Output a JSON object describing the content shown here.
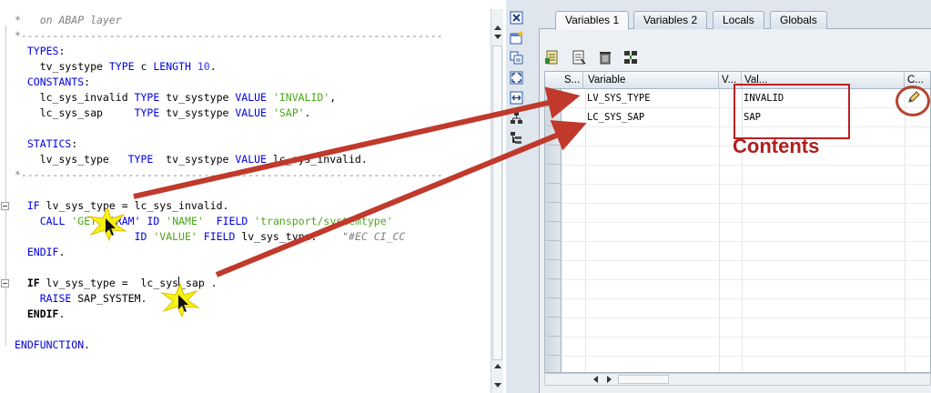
{
  "editor": {
    "lines": [
      {
        "segs": [
          [
            "*   on ABAP layer",
            "comment"
          ]
        ]
      },
      {
        "segs": [
          [
            "*-------------------------------------------------------------------",
            "comment"
          ]
        ]
      },
      {
        "segs": [
          [
            "  ",
            "id"
          ],
          [
            "TYPES",
            "kw"
          ],
          [
            ":",
            "id"
          ]
        ]
      },
      {
        "segs": [
          [
            "    tv_systype ",
            "id"
          ],
          [
            "TYPE",
            "kw"
          ],
          [
            " c ",
            "id"
          ],
          [
            "LENGTH",
            "kw"
          ],
          [
            " ",
            "id"
          ],
          [
            "10",
            "num"
          ],
          [
            ".",
            "id"
          ]
        ]
      },
      {
        "segs": [
          [
            "  ",
            "id"
          ],
          [
            "CONSTANTS",
            "kw"
          ],
          [
            ":",
            "id"
          ]
        ]
      },
      {
        "segs": [
          [
            "    lc_sys_invalid ",
            "id"
          ],
          [
            "TYPE",
            "kw"
          ],
          [
            " tv_systype ",
            "id"
          ],
          [
            "VALUE",
            "kw"
          ],
          [
            " ",
            "id"
          ],
          [
            "'INVALID'",
            "str"
          ],
          [
            ",",
            "id"
          ]
        ]
      },
      {
        "segs": [
          [
            "    lc_sys_sap     ",
            "id"
          ],
          [
            "TYPE",
            "kw"
          ],
          [
            " tv_systype ",
            "id"
          ],
          [
            "VALUE",
            "kw"
          ],
          [
            " ",
            "id"
          ],
          [
            "'SAP'",
            "str"
          ],
          [
            ".",
            "id"
          ]
        ]
      },
      {
        "segs": [
          [
            "",
            "id"
          ]
        ]
      },
      {
        "segs": [
          [
            "  ",
            "id"
          ],
          [
            "STATICS",
            "kw"
          ],
          [
            ":",
            "id"
          ]
        ]
      },
      {
        "segs": [
          [
            "    lv_sys_type   ",
            "id"
          ],
          [
            "TYPE",
            "kw"
          ],
          [
            "  tv_systype ",
            "id"
          ],
          [
            "VALUE",
            "kw"
          ],
          [
            " lc_sys_invalid.",
            "id"
          ]
        ]
      },
      {
        "segs": [
          [
            "*-------------------------------------------------------------------",
            "comment"
          ]
        ]
      },
      {
        "segs": [
          [
            "",
            "id"
          ]
        ]
      },
      {
        "fold": true,
        "segs": [
          [
            "  ",
            "id"
          ],
          [
            "IF",
            "kw"
          ],
          [
            " lv_sys_type = lc_sys_invalid.",
            "id"
          ]
        ]
      },
      {
        "segs": [
          [
            "    ",
            "id"
          ],
          [
            "CALL",
            "kw"
          ],
          [
            " ",
            "id"
          ],
          [
            "'GET",
            "str"
          ],
          [
            " ",
            "id"
          ],
          [
            "PARAM'",
            "kw"
          ],
          [
            " ",
            "id"
          ],
          [
            "ID",
            "kw"
          ],
          [
            " ",
            "id"
          ],
          [
            "'NAME'",
            "str"
          ],
          [
            "  ",
            "id"
          ],
          [
            "FIELD",
            "kw"
          ],
          [
            " ",
            "id"
          ],
          [
            "'transport/systemtype'",
            "str"
          ]
        ]
      },
      {
        "segs": [
          [
            "                   ",
            "id"
          ],
          [
            "ID",
            "kw"
          ],
          [
            " ",
            "id"
          ],
          [
            "'VALUE'",
            "str"
          ],
          [
            " ",
            "id"
          ],
          [
            "FIELD",
            "kw"
          ],
          [
            " lv_sys_type.    ",
            "id"
          ],
          [
            "\"#EC CI_CC",
            "comment"
          ]
        ]
      },
      {
        "segs": [
          [
            "  ",
            "id"
          ],
          [
            "ENDIF",
            "kw"
          ],
          [
            ".",
            "id"
          ]
        ]
      },
      {
        "segs": [
          [
            "",
            "id"
          ]
        ]
      },
      {
        "fold": true,
        "segs": [
          [
            "  ",
            "id"
          ],
          [
            "IF",
            "kwb"
          ],
          [
            " lv_sys_type =  lc_sys",
            "id"
          ],
          [
            "|",
            "caret"
          ],
          [
            "_sap .",
            "id"
          ]
        ]
      },
      {
        "segs": [
          [
            "    ",
            "id"
          ],
          [
            "RAISE",
            "kw"
          ],
          [
            " SAP_SYSTEM.",
            "id"
          ]
        ]
      },
      {
        "segs": [
          [
            "  ",
            "id"
          ],
          [
            "ENDIF",
            "kwb"
          ],
          [
            ".",
            "id"
          ]
        ]
      },
      {
        "segs": [
          [
            "",
            "id"
          ]
        ]
      },
      {
        "segs": [
          [
            "ENDFUNCTION",
            "kw"
          ],
          [
            ".",
            "id"
          ]
        ]
      }
    ]
  },
  "tool_icons": [
    "close-icon",
    "new-window-icon",
    "copy-icon",
    "fullscreen-icon",
    "resize-icon",
    "hierarchy-icon",
    "tree-icon"
  ],
  "debugger": {
    "tabs": [
      "Variables 1",
      "Variables 2",
      "Locals",
      "Globals"
    ],
    "active_tab": 0,
    "toolbar_icons": [
      "insert-icon",
      "save-icon",
      "delete-icon",
      "split-icon"
    ],
    "columns": [
      "S...",
      "Variable",
      "V...",
      "Val...",
      "C..."
    ],
    "rows": [
      {
        "variable": "LV_SYS_TYPE",
        "value": "INVALID"
      },
      {
        "variable": "LC_SYS_SAP",
        "value": "SAP"
      }
    ],
    "annotation": "Contents"
  },
  "colors": {
    "keyword": "#0000e6",
    "string": "#4da619",
    "comment": "#808080",
    "annotation_red": "#c0392b"
  }
}
